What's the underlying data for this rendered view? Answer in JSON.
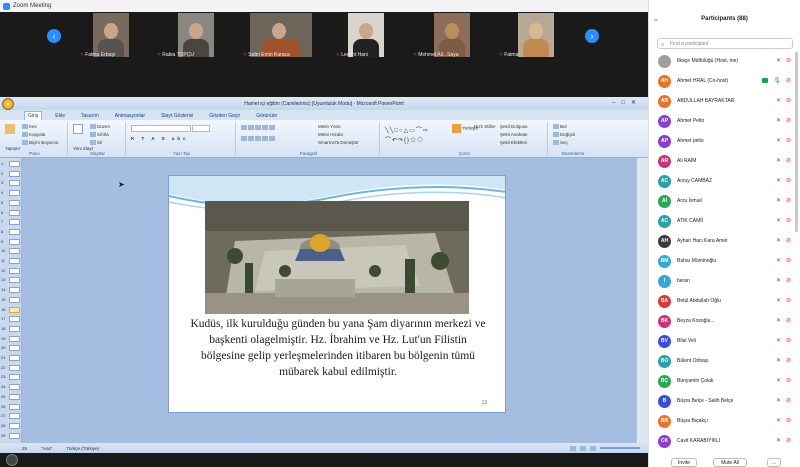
{
  "zoom": {
    "window_title": "Zoom Meeting",
    "participants_visible": [
      {
        "name": "Fatma Erbaşı"
      },
      {
        "name": "Rabia TOPÇU"
      },
      {
        "name": "Sabri Emin Karaca"
      },
      {
        "name": "Levent Hani"
      },
      {
        "name": "Mehmet Ali...Saya"
      },
      {
        "name": "Fatma"
      }
    ]
  },
  "powerpoint": {
    "window_title": "Hamet içi eğitim (Camilerimiz) [Uyumluluk Modu] - Microsoft PowerPoint",
    "tabs": [
      "Giriş",
      "Ekle",
      "Tasarım",
      "Animasyonlar",
      "Slayt Gösterisi",
      "Gözden Geçir",
      "Görünüm"
    ],
    "ribbon_groups": [
      "Pano",
      "Slaytlar",
      "Yazı Tipi",
      "Paragraf",
      "Çizim",
      "Düzenleme"
    ],
    "ribbon_items": {
      "paste": "Yapıştır",
      "cut": "Kes",
      "copy": "Kopyala",
      "format_painter": "Biçim Boyacısı",
      "new_slide": "Yeni Slayt",
      "layout": "Düzen",
      "reset": "Sıfırla",
      "delete": "Sil",
      "text_direction": "Metin Yönü",
      "align_text": "Metni Hizala",
      "smartart": "SmartArt'a Dönüştür",
      "arrange": "Yerleştir",
      "quick_styles": "Hızlı Stiller",
      "shape_fill": "Şekil Dolgusu",
      "shape_outline": "Şekil Anahattı",
      "shape_effects": "Şekil Efektleri",
      "find": "Bul",
      "replace": "Değiştir",
      "select": "Seç"
    },
    "slide_numbers": [
      "1",
      "2",
      "3",
      "4",
      "5",
      "6",
      "7",
      "8",
      "9",
      "10",
      "11",
      "12",
      "13",
      "14",
      "15",
      "16",
      "17",
      "18",
      "19",
      "20",
      "21",
      "22",
      "23",
      "24",
      "25",
      "26",
      "27",
      "28",
      "29"
    ],
    "selected_slide": "16",
    "slide": {
      "body_text": "Kudüs, ilk kurulduğu günden bu yana Şam diyarının merkezi ve başkenti olagelmiştir. Hz. İbrahim ve Hz. Lut'un Filistin bölgesine gelip yerleşmelerinden itibaren bu bölgenin tümü mübarek kabul edilmiştir.",
      "page_number": "13"
    },
    "status": {
      "slide_indicator": "29",
      "theme": "\"Ana\"",
      "language": "Türkçe (Türkiye)"
    }
  },
  "participants_panel": {
    "title": "Participants (88)",
    "search_placeholder": "Find a participant",
    "list": [
      {
        "initials": "",
        "name": "Ilkaçe Müftülüğü (Host, me)",
        "color": "#9aa0a6",
        "mic": "off",
        "video": "off"
      },
      {
        "initials": "AH",
        "name": "Ahmet HRAL (Co-host)",
        "color": "#e5742c",
        "mic": "on",
        "video": "off",
        "sharing": true
      },
      {
        "initials": "AB",
        "name": "ABDULLAH BAYRAKTAR",
        "color": "#e5742c",
        "mic": "off",
        "video": "off"
      },
      {
        "initials": "AP",
        "name": "Ahmet Pelto",
        "color": "#8a3fd1",
        "mic": "off",
        "video": "off"
      },
      {
        "initials": "AP",
        "name": "Ahmet pelto",
        "color": "#8a3fd1",
        "mic": "off",
        "video": "off"
      },
      {
        "initials": "AR",
        "name": "Ali RAİM",
        "color": "#c9357a",
        "mic": "off",
        "video": "off"
      },
      {
        "initials": "AC",
        "name": "Arzuy CAMBAZ",
        "color": "#2aa0a8",
        "mic": "off",
        "video": "off"
      },
      {
        "initials": "Aİ",
        "name": "Arzu İsmail",
        "color": "#2aa856",
        "mic": "off",
        "video": "off"
      },
      {
        "initials": "AC",
        "name": "ATIK CAMİİ",
        "color": "#2aa0a8",
        "mic": "off",
        "video": "off"
      },
      {
        "initials": "AH",
        "name": "Ayhan Hacı Kara Amet",
        "color": "#3b3b3b",
        "mic": "off",
        "video": "off"
      },
      {
        "initials": "BM",
        "name": "Bahar Müminoğlu",
        "color": "#3aa3d8",
        "mic": "off",
        "video": "off"
      },
      {
        "initials": "I",
        "name": "beran",
        "color": "#3aa3d8",
        "mic": "off",
        "video": "off"
      },
      {
        "initials": "BA",
        "name": "Betül Abdullah Oğlu",
        "color": "#d83a3a",
        "mic": "off",
        "video": "off"
      },
      {
        "initials": "BK",
        "name": "Beyza Kosoğlu...",
        "color": "#c9357a",
        "mic": "off",
        "video": "off"
      },
      {
        "initials": "BV",
        "name": "Bilal Veli",
        "color": "#3a4fd8",
        "mic": "off",
        "video": "off"
      },
      {
        "initials": "BO",
        "name": "Bülent Onbaşı",
        "color": "#2aa0a8",
        "mic": "off",
        "video": "off"
      },
      {
        "initials": "BÇ",
        "name": "Bünyamin Çolak",
        "color": "#2aa856",
        "mic": "off",
        "video": "off"
      },
      {
        "initials": "B",
        "name": "Büşra Belçe - Salih Belçe",
        "color": "#3a4fd8",
        "mic": "off",
        "video": "off"
      },
      {
        "initials": "BB",
        "name": "Büşra Bıçakçı",
        "color": "#e5742c",
        "mic": "off",
        "video": "off"
      },
      {
        "initials": "CK",
        "name": "Cavit KARABIYIKLI",
        "color": "#8a3fd1",
        "mic": "off",
        "video": "off"
      }
    ],
    "footer_buttons": [
      "Invite",
      "Mute All",
      "..."
    ]
  }
}
